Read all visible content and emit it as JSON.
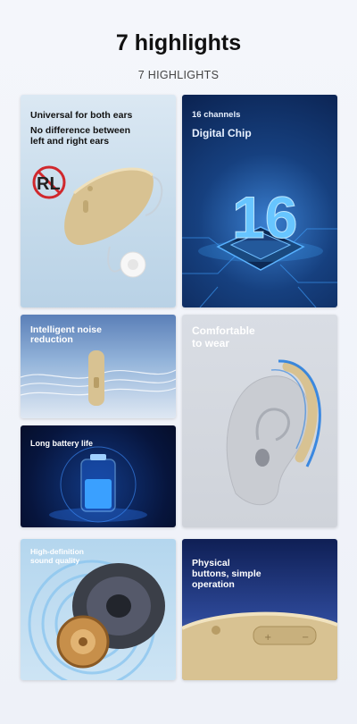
{
  "header": {
    "title": "7 highlights",
    "subtitle": "7 HIGHLIGHTS"
  },
  "cards": [
    {
      "line1": "Universal for both ears",
      "line2": "No difference between",
      "line3": "left and right ears",
      "icon_text": "RL"
    },
    {
      "line1": "16 channels",
      "line2": "Digital Chip",
      "big_number": "16"
    },
    {
      "line1": "Intelligent noise",
      "line2": "reduction"
    },
    {
      "line1": "Comfortable",
      "line2": "to wear"
    },
    {
      "line1": "Long battery life"
    },
    {
      "line1": "High-definition",
      "line2": "sound quality"
    },
    {
      "line1": "Physical",
      "line2": "buttons, simple",
      "line3": "operation"
    }
  ],
  "colors": {
    "accent_blue": "#1e63d6",
    "device_beige": "#d8c292",
    "prohibit_red": "#d0282d"
  }
}
